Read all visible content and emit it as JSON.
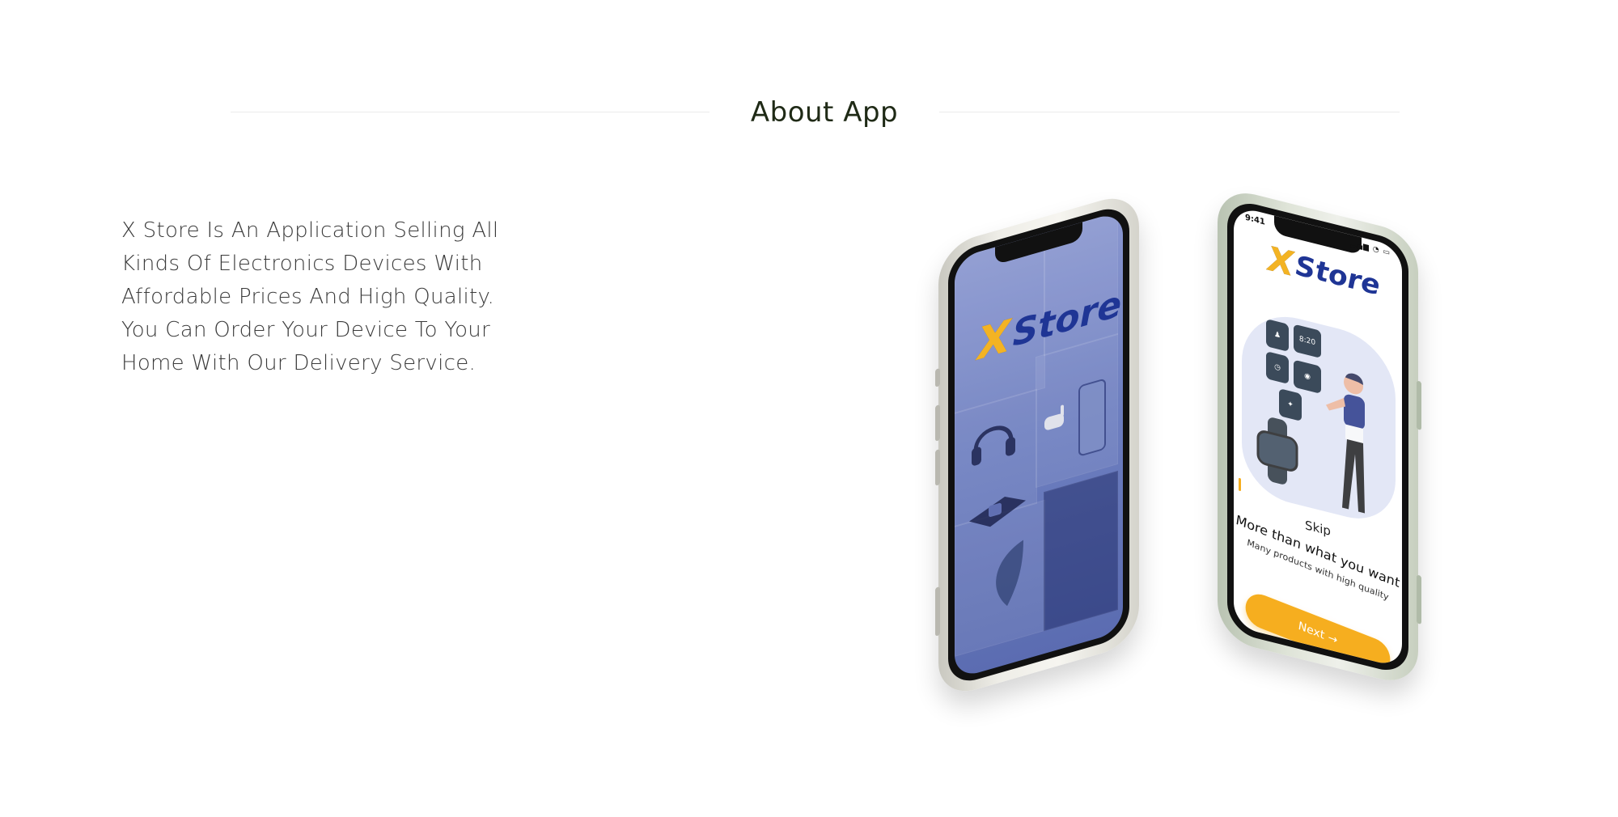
{
  "section": {
    "title": "About App"
  },
  "about": {
    "lines": [
      "X Store Is An Application Selling All",
      "Kinds Of Electronics Devices With",
      "Affordable Prices And High Quality.",
      "You Can Order Your Device To Your",
      "Home With Our Delivery Service."
    ]
  },
  "splash_screen": {
    "logo_x": "X",
    "logo_word": "Store"
  },
  "onboarding_screen": {
    "status_time": "9:41",
    "logo_x": "X",
    "logo_word": "Store",
    "watch_time": "8:20",
    "skip_label": "Skip",
    "title": "More than what you want",
    "subtitle": "Many products with high quality",
    "next_label": "Next →"
  },
  "colors": {
    "heading": "#1f2a16",
    "body_text": "#3b3b3b",
    "brand_blue": "#1f3595",
    "brand_yellow": "#f6ae1f",
    "splash_bg": "#6e7fc0"
  }
}
